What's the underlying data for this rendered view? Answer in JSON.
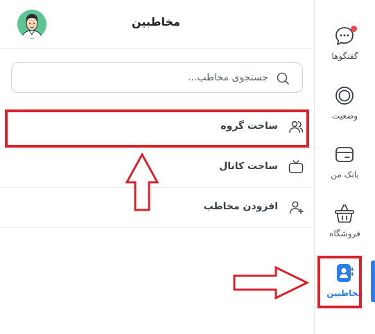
{
  "header": {
    "title": "مخاطبین"
  },
  "search": {
    "placeholder": "جستجوی مخاطب..."
  },
  "actions": [
    {
      "label": "ساخت گروه",
      "icon": "group-icon"
    },
    {
      "label": "ساخت کانال",
      "icon": "tv-icon"
    },
    {
      "label": "افزودن مخاطب",
      "icon": "add-user-icon"
    }
  ],
  "sidebar": {
    "items": [
      {
        "label": "گفتگوها",
        "icon": "chat-icon",
        "has_notification": true
      },
      {
        "label": "وضعیت",
        "icon": "status-icon"
      },
      {
        "label": "بانک من",
        "icon": "card-icon"
      },
      {
        "label": "فروشگاه",
        "icon": "basket-icon"
      },
      {
        "label": "مخاطبین",
        "icon": "contacts-icon",
        "active": true
      }
    ]
  },
  "colors": {
    "accent": "#2b7de9",
    "highlight": "#d9232b",
    "avatar_bg": "#5cc592",
    "notification": "#f1484f"
  }
}
